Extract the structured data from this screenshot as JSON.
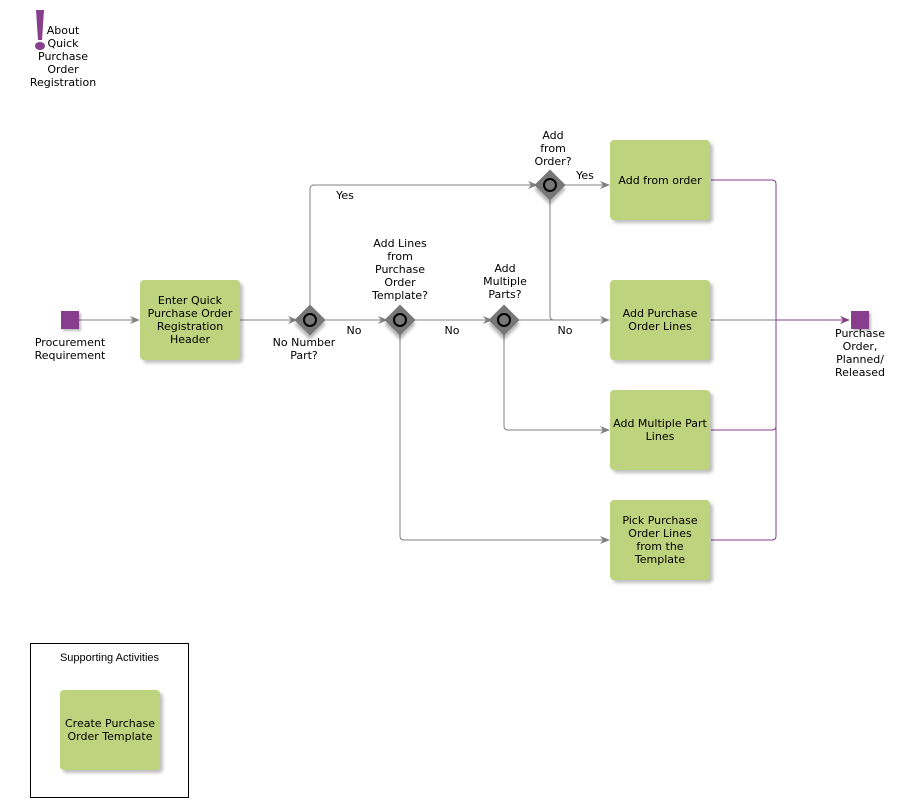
{
  "about": {
    "icon": "exclamation-icon",
    "label": "About\nQuick\nPurchase\nOrder\nRegistration"
  },
  "colors": {
    "event": "#883e8c",
    "task": "#bdd37d",
    "gateway": "#777777",
    "flow_gray": "#808080",
    "flow_purple": "#883e8c"
  },
  "events": {
    "start": "Procurement\nRequirement",
    "end": "Purchase\nOrder,\nPlanned/\nReleased"
  },
  "tasks": {
    "enter_header": "Enter Quick\nPurchase Order\nRegistration\nHeader",
    "add_from_order": "Add from order",
    "add_po_lines": "Add Purchase\nOrder Lines",
    "add_multiple_part_lines": "Add Multiple Part\nLines",
    "pick_po_lines": "Pick Purchase\nOrder Lines\nfrom the\nTemplate",
    "create_template": "Create Purchase\nOrder Template"
  },
  "gateways": {
    "no_number_part": "No Number\nPart?",
    "add_lines_template": "Add Lines\nfrom\nPurchase\nOrder\nTemplate?",
    "add_multiple_parts": "Add\nMultiple\nParts?",
    "add_from_order": "Add\nfrom\nOrder?"
  },
  "flow_labels": {
    "yes_1": "Yes",
    "no_1": "No",
    "no_2": "No",
    "no_3": "No",
    "yes_2": "Yes"
  },
  "supporting": {
    "title": "Supporting Activities"
  }
}
